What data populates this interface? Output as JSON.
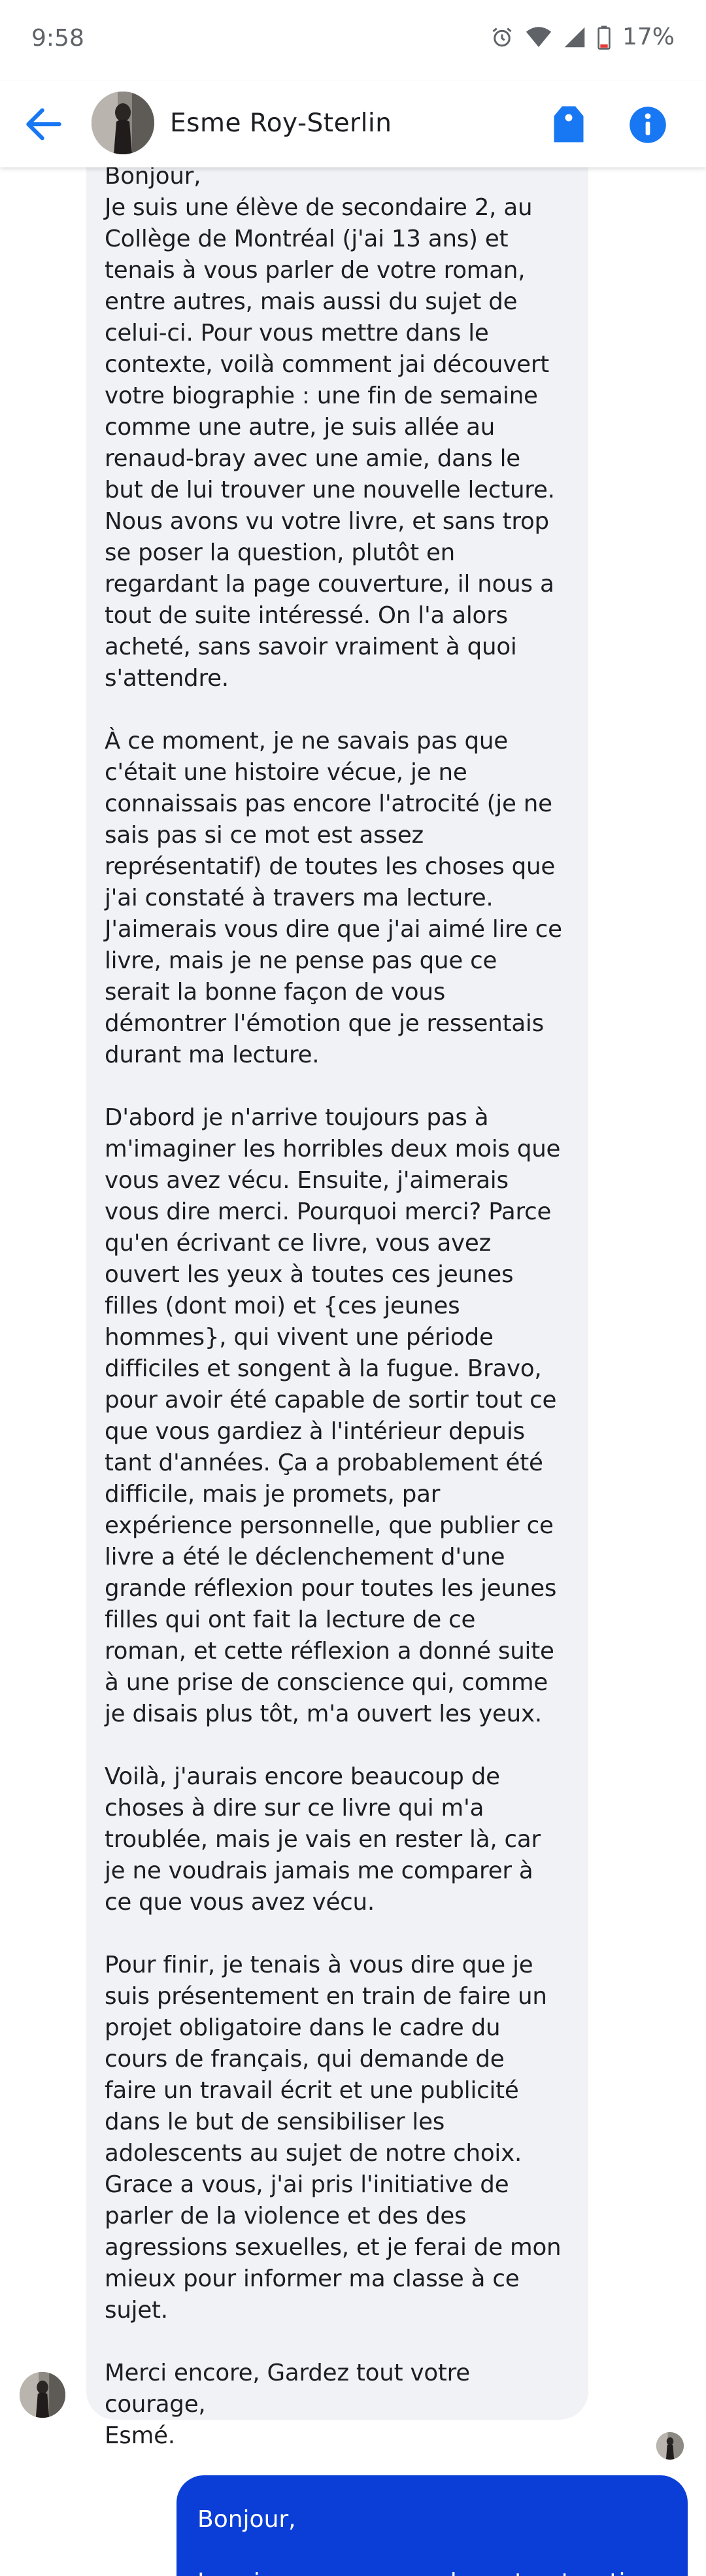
{
  "status_bar": {
    "time": "9:58",
    "battery": "17%",
    "icons": [
      "alarm-icon",
      "wifi-icon",
      "signal-icon",
      "battery-icon"
    ]
  },
  "header": {
    "contact_name": "Esme Roy-Sterlin",
    "back_icon": "back-arrow-icon",
    "actions": [
      "tag-icon",
      "info-icon"
    ],
    "accent_color": "#1877f2"
  },
  "conversation": {
    "incoming": {
      "paragraphs": [
        "Bonjour,\nJe suis une élève de secondaire 2, au Collège de Montréal (j'ai 13 ans) et tenais à vous parler de votre roman, entre autres, mais aussi du sujet de celui-ci. Pour vous mettre dans le contexte, voilà comment jai découvert votre biographie : une fin de semaine comme une autre, je suis allée au renaud-bray avec une amie, dans le but de lui trouver une nouvelle lecture. Nous avons vu votre livre, et sans trop se poser la question, plutôt en regardant la page couverture, il nous a tout de suite intéressé. On l'a alors acheté, sans savoir vraiment à quoi s'attendre.",
        "À ce moment, je ne savais pas que c'était une histoire vécue, je ne connaissais pas encore l'atrocité (je ne sais pas si ce mot est assez représentatif) de toutes les choses que j'ai constaté à travers ma lecture. J'aimerais vous dire que j'ai aimé lire ce livre, mais je ne pense pas que ce serait la bonne façon de vous démontrer l'émotion que je ressentais durant ma lecture.",
        "D'abord je n'arrive toujours pas à m'imaginer les horribles deux mois que vous avez vécu. Ensuite, j'aimerais vous dire merci. Pourquoi merci? Parce qu'en écrivant ce livre, vous avez ouvert les yeux à toutes ces jeunes filles (dont moi) et {ces jeunes hommes}, qui vivent une période difficiles et songent à la fugue. Bravo, pour avoir été capable de sortir tout ce que vous gardiez à l'intérieur depuis tant d'années. Ça a probablement été difficile, mais je promets, par expérience personnelle, que publier ce livre a été le déclenchement d'une grande réflexion pour toutes les jeunes filles qui ont fait la lecture de ce roman, et cette réflexion a donné suite à une prise de conscience qui, comme je disais plus tôt, m'a ouvert les yeux.",
        "Voilà, j'aurais encore beaucoup de choses à dire sur ce livre qui m'a troublée, mais je vais en rester là, car je ne voudrais jamais me comparer à ce que vous avez vécu.",
        "Pour finir, je tenais à vous dire que je suis présentement en train de faire un projet obligatoire dans le cadre du cours de français, qui demande de faire un travail écrit et une publicité dans le but de sensibiliser les adolescents au sujet de notre choix. Grace a vous, j'ai pris l'initiative de parler de la violence et des des agressions sexuelles, et je ferai de mon mieux pour informer ma classe à ce sujet.",
        "Merci encore, Gardez tout votre courage,\nEsmé."
      ],
      "bubble_color": "#f1f2f6"
    },
    "outgoing": {
      "paragraphs": [
        "Bonjour,",
        "Je suis en processus de restructuration"
      ],
      "bubble_color": "#0a3ed6"
    }
  }
}
